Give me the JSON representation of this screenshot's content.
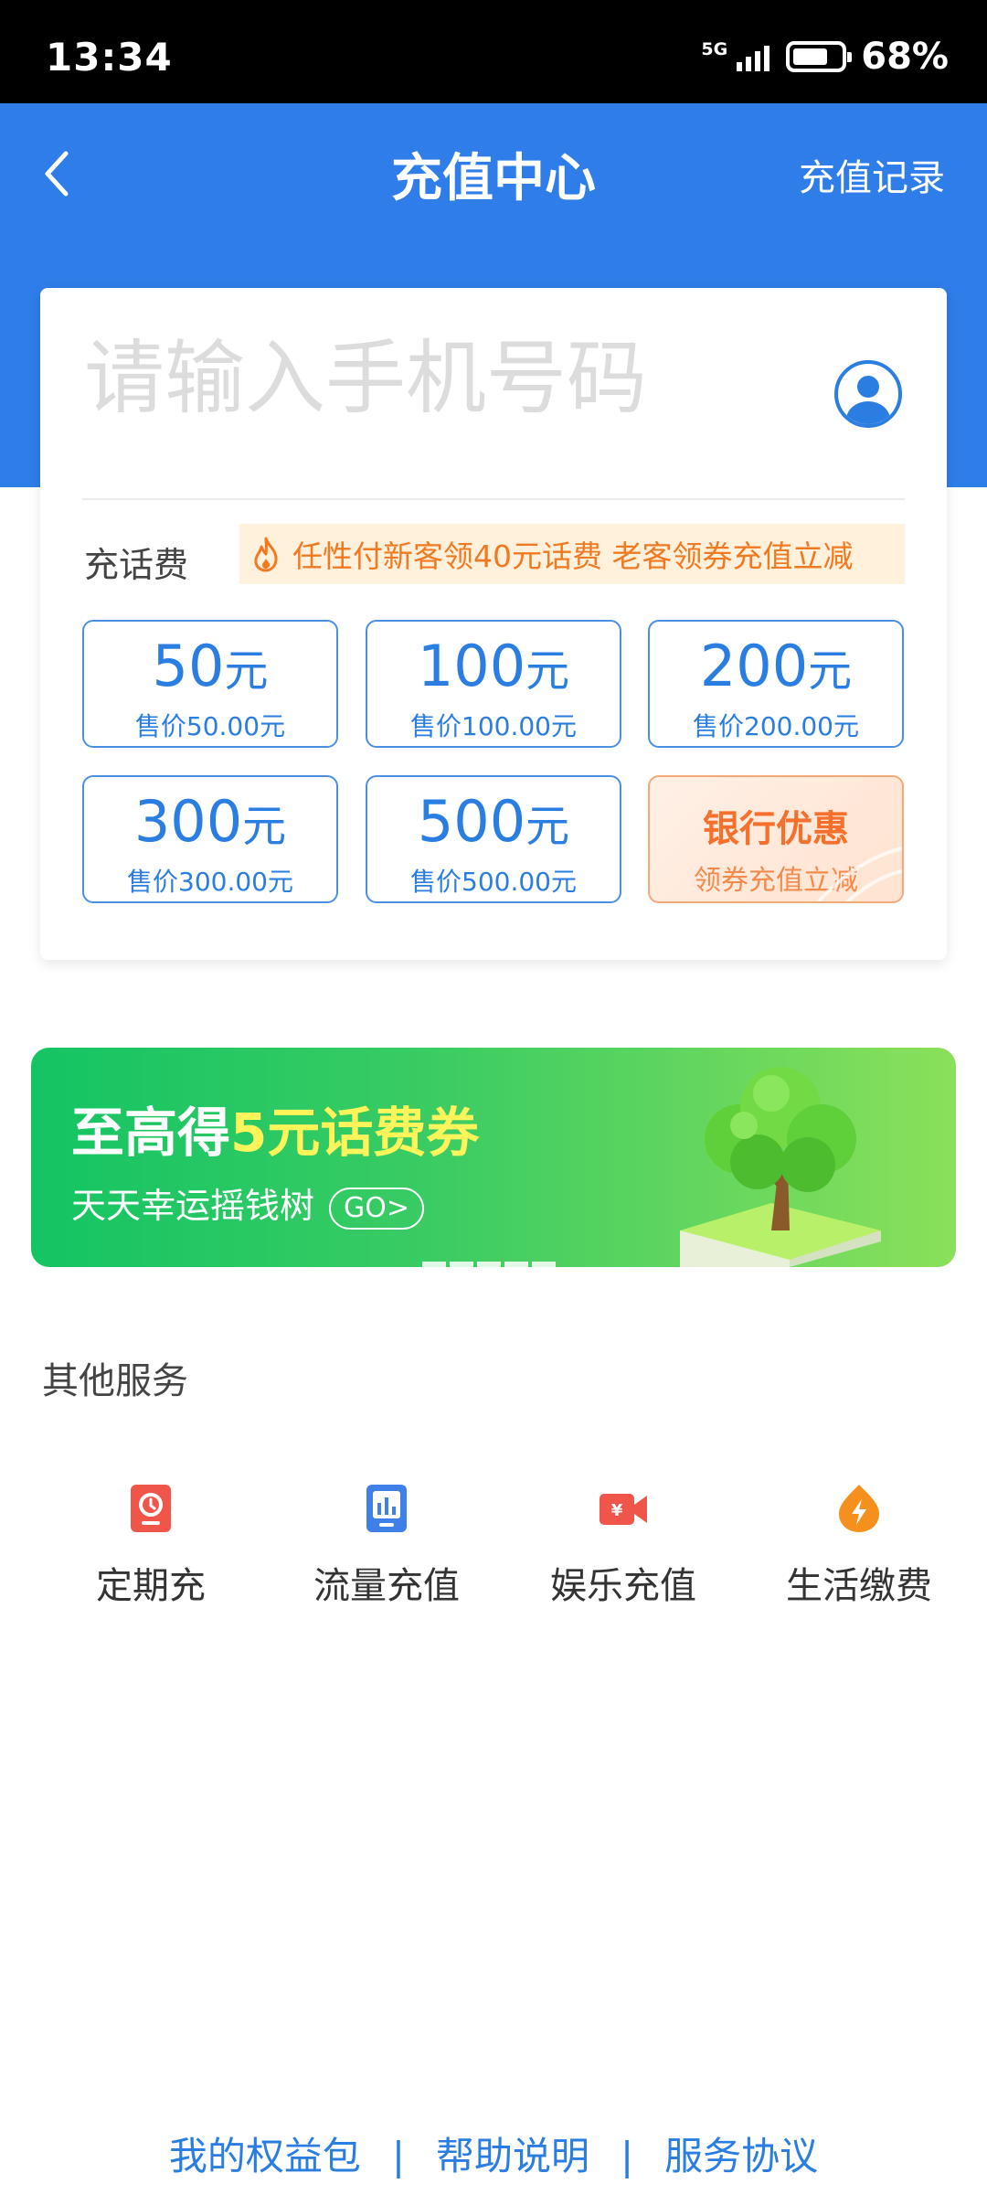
{
  "status_bar": {
    "time": "13:34",
    "network": "5G",
    "battery": "68%"
  },
  "header": {
    "title": "充值中心",
    "history_link": "充值记录"
  },
  "phone_input": {
    "placeholder": "请输入手机号码",
    "value": ""
  },
  "recharge": {
    "section_label": "充话费",
    "promo_text": "任性付新客领40元话费 老客领券充值立减",
    "options": [
      {
        "amount": "50",
        "unit": "元",
        "price": "售价50.00元"
      },
      {
        "amount": "100",
        "unit": "元",
        "price": "售价100.00元"
      },
      {
        "amount": "200",
        "unit": "元",
        "price": "售价200.00元"
      },
      {
        "amount": "300",
        "unit": "元",
        "price": "售价300.00元"
      },
      {
        "amount": "500",
        "unit": "元",
        "price": "售价500.00元"
      }
    ],
    "bank_offer": {
      "title": "银行优惠",
      "subtitle": "领券充值立减"
    }
  },
  "promo_banner": {
    "title_prefix": "至高得",
    "title_highlight": "5元话费券",
    "subtitle": "天天幸运摇钱树",
    "go_label": "GO>"
  },
  "services": {
    "title": "其他服务",
    "items": [
      {
        "label": "定期充",
        "icon": "calendar-recharge-icon",
        "color": "#f0554a"
      },
      {
        "label": "流量充值",
        "icon": "data-chart-icon",
        "color": "#3f7fe8"
      },
      {
        "label": "娱乐充值",
        "icon": "video-camera-icon",
        "color": "#f0554a"
      },
      {
        "label": "生活缴费",
        "icon": "lightning-icon",
        "color": "#f5901e"
      }
    ]
  },
  "footer": {
    "links": [
      "我的权益包",
      "帮助说明",
      "服务协议"
    ],
    "separator": "|"
  },
  "colors": {
    "header": "#2f7de9",
    "accent": "#2a7de1",
    "promo": "#f07a21",
    "banner": "#14c463"
  }
}
